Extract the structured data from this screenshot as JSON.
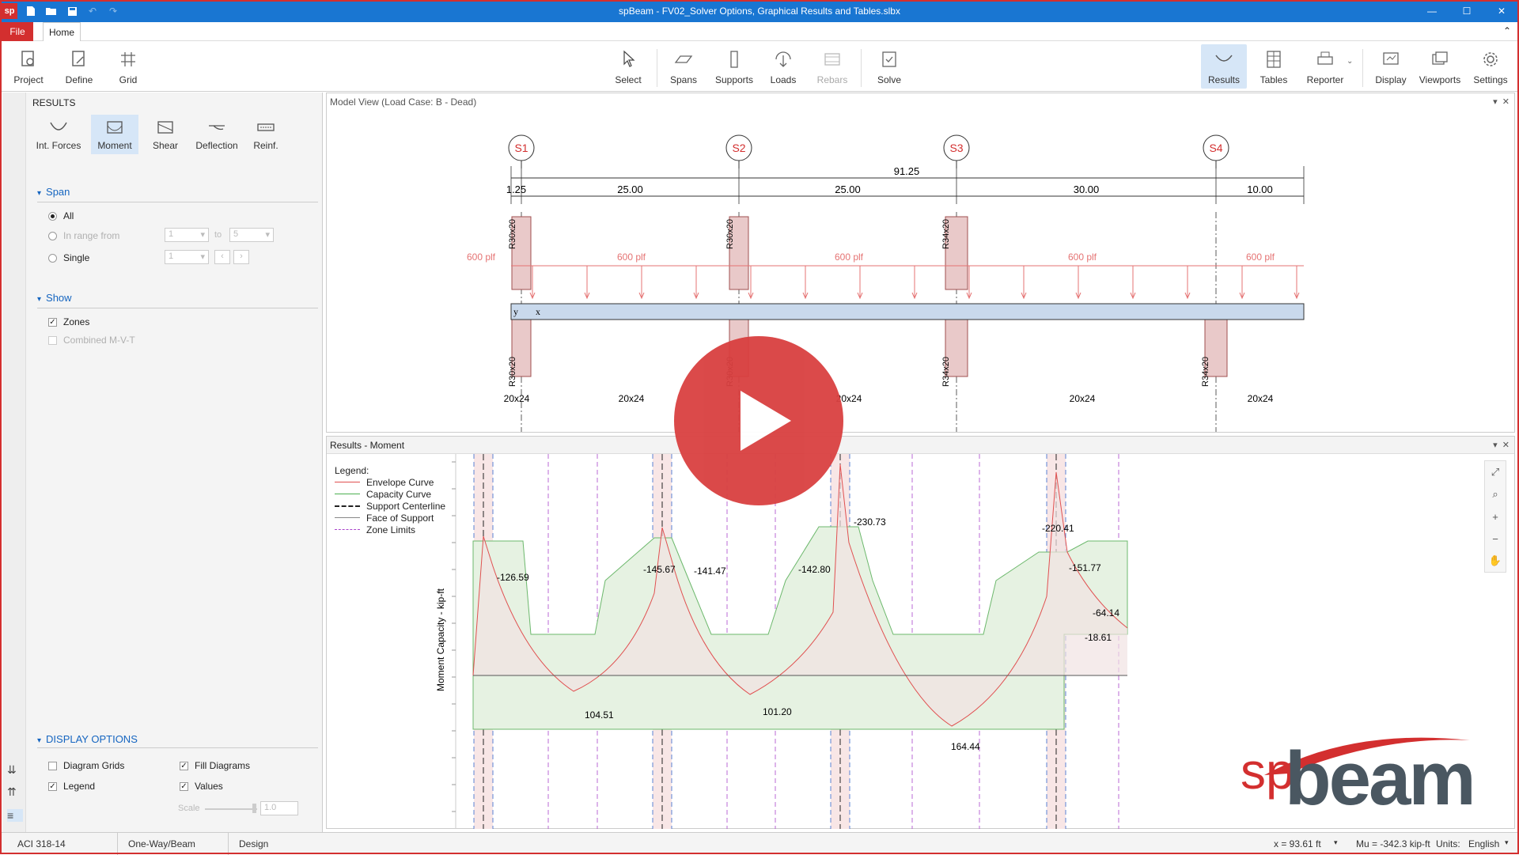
{
  "app": {
    "title": "spBeam - FV02_Solver Options, Graphical Results and Tables.slbx",
    "logo": "sp"
  },
  "ribbon": {
    "tabs": [
      "File",
      "Home"
    ],
    "left_buttons": [
      "Project",
      "Define",
      "Grid"
    ],
    "center_buttons": [
      "Select",
      "Spans",
      "Supports",
      "Loads",
      "Rebars",
      "Solve"
    ],
    "right_buttons": [
      "Results",
      "Tables",
      "Reporter",
      "Display",
      "Viewports",
      "Settings"
    ]
  },
  "results_panel": {
    "header": "RESULTS",
    "types": [
      "Int. Forces",
      "Moment",
      "Shear",
      "Deflection",
      "Reinf."
    ],
    "span_section": "Span",
    "span_options": {
      "all": "All",
      "range": "In range from",
      "to": "to",
      "single": "Single",
      "from_val": "1",
      "to_val": "5",
      "single_val": "1"
    },
    "show_section": "Show",
    "show_options": {
      "zones": "Zones",
      "combined": "Combined M-V-T"
    },
    "display_section": "DISPLAY OPTIONS",
    "display_options": {
      "grids": "Diagram Grids",
      "fill": "Fill Diagrams",
      "legend": "Legend",
      "values": "Values",
      "scale": "Scale",
      "scale_val": "1.0"
    }
  },
  "model_view": {
    "title": "Model View (Load Case: B - Dead)",
    "supports": [
      "S1",
      "S2",
      "S3",
      "S4"
    ],
    "total_length": "91.25",
    "spans": [
      "1.25",
      "25.00",
      "25.00",
      "30.00",
      "10.00"
    ],
    "columns_top": [
      "R30x20",
      "R30x20",
      "R34x20"
    ],
    "columns_bottom": [
      "R30x20",
      "R30x20",
      "R34x20",
      "R34x20"
    ],
    "load_labels": [
      "600 plf",
      "600 plf",
      "600 plf",
      "600 plf",
      "600 plf"
    ],
    "beam_sections": [
      "20x24",
      "20x24",
      "20x24",
      "20x24",
      "20x24"
    ],
    "axis_labels": {
      "y": "y",
      "x": "x"
    }
  },
  "results_view": {
    "title": "Results - Moment",
    "legend_title": "Legend:",
    "legend": [
      {
        "label": "Envelope Curve",
        "color": "#e05050"
      },
      {
        "label": "Capacity Curve",
        "color": "#4caf50"
      },
      {
        "label": "Support Centerline",
        "color": "#222222"
      },
      {
        "label": "Face of Support",
        "color": "#888888"
      },
      {
        "label": "Zone Limits",
        "color": "#aa44cc"
      }
    ],
    "y_axis_label": "Moment Capacity - kip-ft",
    "value_labels": [
      "-126.59",
      "-145.67",
      "-141.47",
      "-142.80",
      "-230.73",
      "-220.41",
      "-151.77",
      "-64.14",
      "-18.61",
      "104.51",
      "101.20",
      "164.44"
    ]
  },
  "status": {
    "code": "ACI 318-14",
    "type": "One-Way/Beam",
    "mode": "Design",
    "x": "x = 93.61 ft",
    "mu": "Mu = -342.3 kip-ft",
    "units_label": "Units:",
    "units": "English"
  },
  "brand": {
    "sp": "sp",
    "beam": "beam"
  },
  "colors": {
    "accent": "#1976d2",
    "brand_red": "#d32f2f"
  }
}
